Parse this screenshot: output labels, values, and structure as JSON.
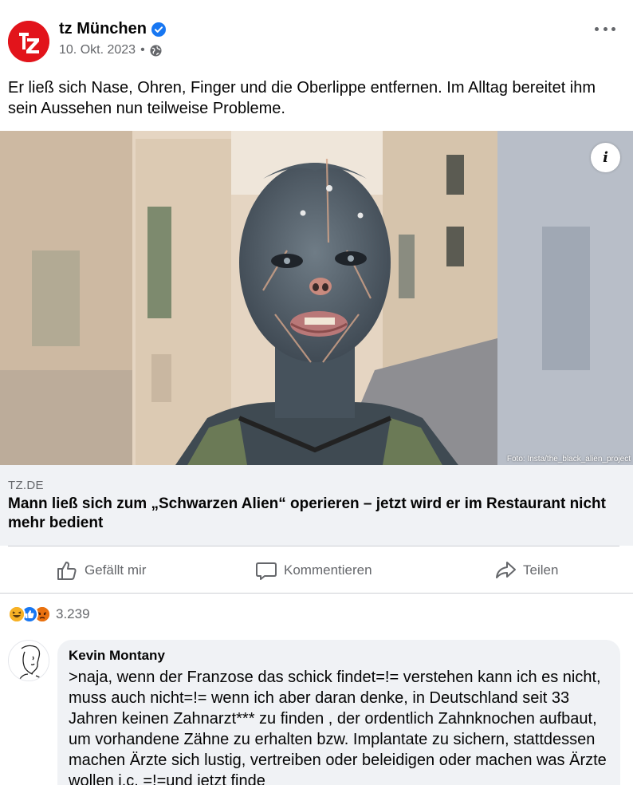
{
  "post": {
    "page_name": "tz München",
    "date": "10. Okt. 2023",
    "separator": "•",
    "text": "Er ließ sich Nase, Ohren, Finger und die Oberlippe entfernen. Im Alltag bereitet ihm sein Aussehen nun teilweise Probleme.",
    "photo_credit": "Foto: Insta/the_black_alien_project",
    "info_glyph": "i"
  },
  "link": {
    "domain": "TZ.DE",
    "title": "Mann ließ sich zum „Schwarzen Alien“ operieren – jetzt wird er im Restaurant nicht mehr bedient"
  },
  "actions": {
    "like": "Gefällt mir",
    "comment": "Kommentieren",
    "share": "Teilen"
  },
  "reactions": {
    "count": "3.239",
    "icons": [
      "haha-icon",
      "like-icon",
      "angry-icon"
    ]
  },
  "comment": {
    "author": "Kevin Montany",
    "text": ">naja, wenn der Franzose das schick findet=!= verstehen kann ich es nicht, muss auch nicht=!= wenn ich aber daran denke, in Deutschland seit 33 Jahren keinen Zahnarzt*** zu finden , der ordentlich Zahnknochen aufbaut, um vorhandene Zähne zu erhalten bzw. Implantate zu sichern, stattdessen machen Ärzte sich lustig, vertreiben oder beleidigen oder machen was Ärzte wollen i.c. =!=und  jetzt finde"
  },
  "colors": {
    "brand_red": "#e2141b",
    "verified_blue": "#1877f2",
    "secondary_text": "#65676b",
    "bubble_bg": "#f0f2f5"
  }
}
